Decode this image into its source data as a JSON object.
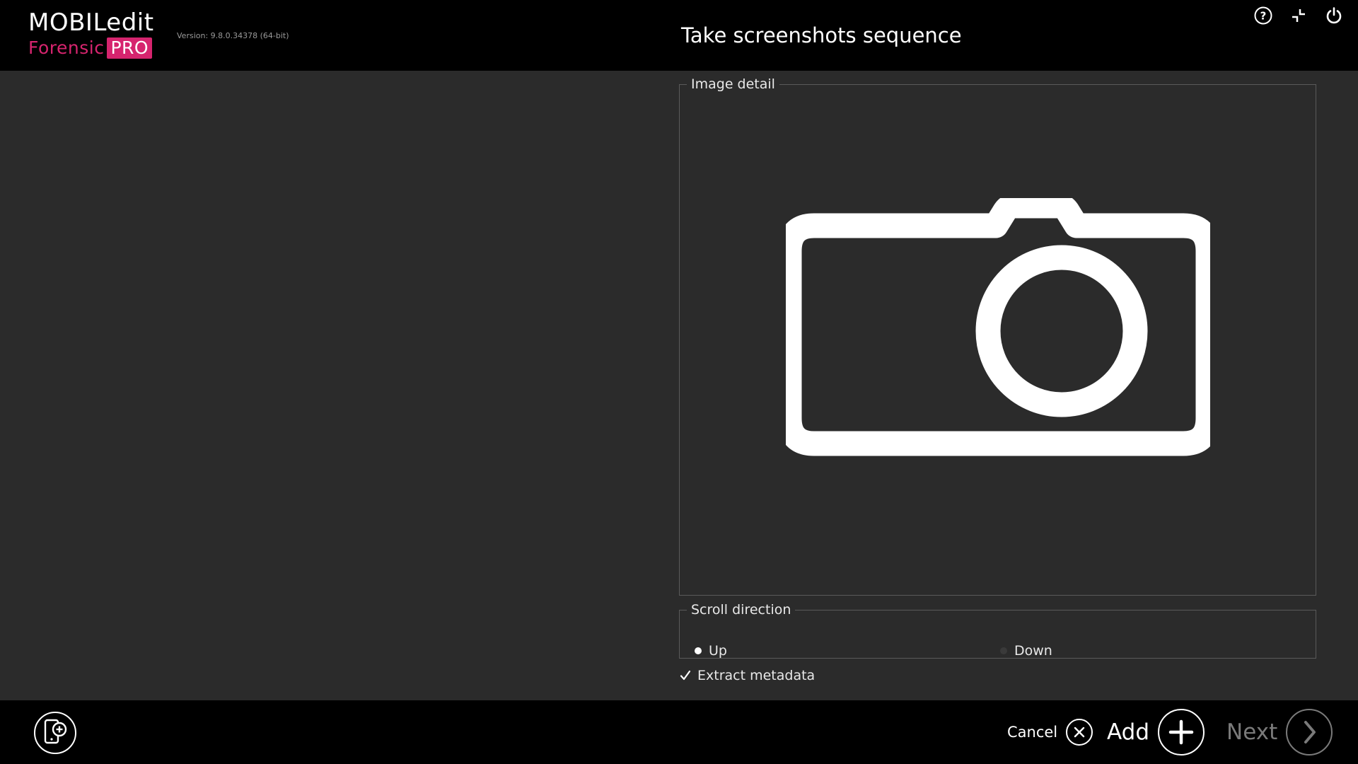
{
  "app": {
    "logo_name": "MOBILedit",
    "logo_sub": "Forensic",
    "logo_badge": "PRO",
    "version": "Version: 9.8.0.34378 (64-bit)",
    "brand_color": "#d6246e"
  },
  "header": {
    "title": "Take screenshots sequence",
    "icons": [
      "help-icon",
      "minimize-icon",
      "power-icon"
    ]
  },
  "image_detail": {
    "legend": "Image detail",
    "placeholder_icon": "camera-icon"
  },
  "scroll_direction": {
    "legend": "Scroll direction",
    "options": [
      {
        "label": "Up",
        "selected": true
      },
      {
        "label": "Down",
        "selected": false
      }
    ]
  },
  "extract_metadata": {
    "label": "Extract metadata",
    "checked": true
  },
  "footer": {
    "add_device_icon": "add-device-icon",
    "cancel_label": "Cancel",
    "add_label": "Add",
    "next_label": "Next",
    "next_enabled": false
  }
}
